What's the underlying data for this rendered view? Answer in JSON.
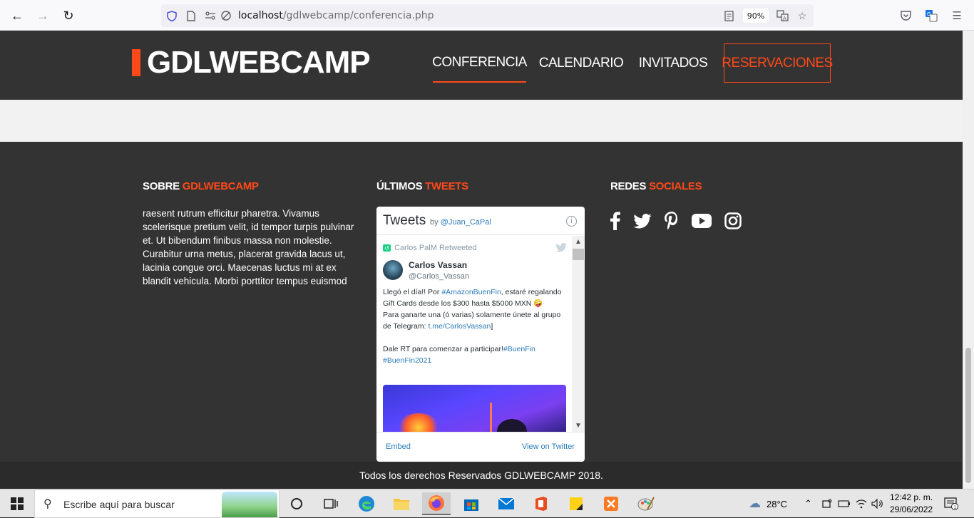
{
  "browser": {
    "url_host": "localhost",
    "url_path": "/gdlwebcamp/conferencia.php",
    "zoom": "90%"
  },
  "site": {
    "logo": "GDLWEBCAMP",
    "nav": [
      "CONFERENCIA",
      "CALENDARIO",
      "INVITADOS",
      "RESERVACIONES"
    ]
  },
  "footer": {
    "about_heading_plain": "SOBRE ",
    "about_heading_accent": "GDLWEBCAMP",
    "about_text": "raesent rutrum efficitur pharetra. Vivamus scelerisque pretium velit, id tempor turpis pulvinar et. Ut bibendum finibus massa non molestie. Curabitur urna metus, placerat gravida lacus ut, lacinia congue orci. Maecenas luctus mi at ex blandit vehicula. Morbi porttitor tempus euismod",
    "tweets_heading_plain": "ÚLTIMOS ",
    "tweets_heading_accent": "TWEETS",
    "social_heading_plain": "REDES ",
    "social_heading_accent": "SOCIALES",
    "copyright": "Todos los derechos Reservados GDLWEBCAMP 2018."
  },
  "twitter": {
    "title": "Tweets",
    "by": "by ",
    "account": "@Juan_CaPal",
    "retweeted_by": "Carlos PalM Retweeted",
    "author_name": "Carlos Vassan",
    "author_handle": "@Carlos_Vassan",
    "text_1": "Llegó el día!! Por ",
    "hashtag_1": "#AmazonBuenFin",
    "text_2": ", estaré regalando Gift Cards desde los $300 hasta $5000 MXN 🤪",
    "text_3": "Para ganarte una (ó varias) solamente únete al grupo de Telegram: ",
    "link_1": "t.me/CarlosVassan",
    "text_4": "]",
    "text_5": "Dale RT para comenzar a participar!",
    "hashtag_2": "#BuenFin",
    "hashtag_3": "#BuenFin2021",
    "embed": "Embed",
    "view": "View on Twitter"
  },
  "social_icons": [
    "facebook-icon",
    "twitter-icon",
    "pinterest-icon",
    "youtube-icon",
    "instagram-icon"
  ],
  "taskbar": {
    "search_placeholder": "Escribe aquí para buscar",
    "temperature": "28°C",
    "time": "12:42 p. m.",
    "date": "29/06/2022"
  },
  "colors": {
    "accent": "#fe4918",
    "dark": "#333333"
  }
}
